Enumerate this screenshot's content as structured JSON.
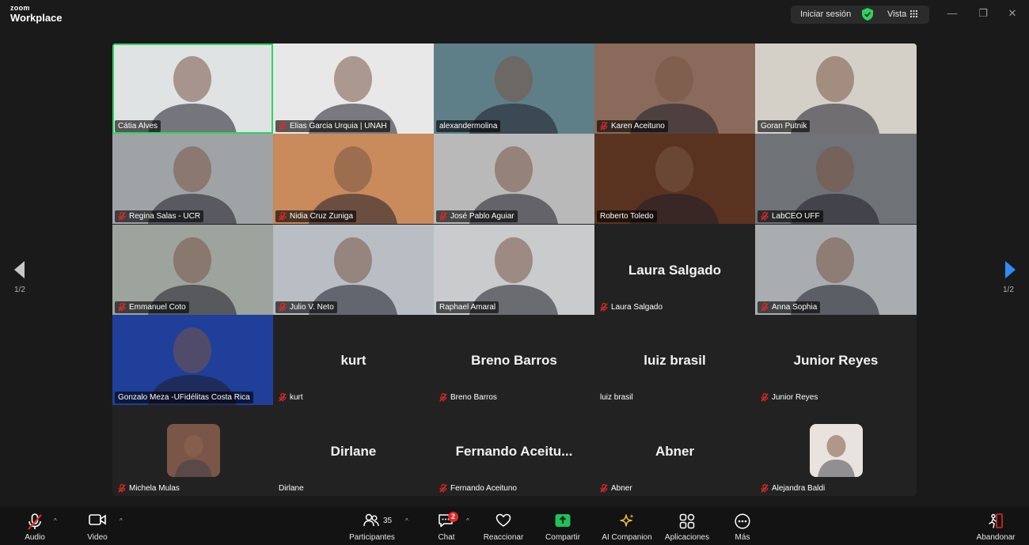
{
  "app": {
    "logo_small": "zoom",
    "logo_main": "Workplace",
    "signin_label": "Iniciar sesión",
    "view_label": "Vista"
  },
  "navigation": {
    "left_page": "1/2",
    "right_page": "1/2"
  },
  "participants": [
    {
      "name": "Cátia Alves",
      "muted": false,
      "video": true,
      "active": true,
      "color": "#dfe3e4"
    },
    {
      "name": "Elias Garcia Urquia | UNAH",
      "muted": true,
      "video": true,
      "color": "#e8e8e8"
    },
    {
      "name": "alexandermolina",
      "muted": false,
      "video": true,
      "color": "#5e7f88"
    },
    {
      "name": "Karen Aceituno",
      "muted": true,
      "video": true,
      "color": "#8a6a5a"
    },
    {
      "name": "Goran Putnik",
      "muted": false,
      "video": true,
      "color": "#d4d0c8"
    },
    {
      "name": "Regina Salas - UCR",
      "muted": true,
      "video": true,
      "color": "#9fa3a6"
    },
    {
      "name": "Nidia Cruz Zuniga",
      "muted": true,
      "video": true,
      "color": "#c98a5c"
    },
    {
      "name": "José Pablo Aguiar",
      "muted": true,
      "video": true,
      "color": "#b9b9b9"
    },
    {
      "name": "Roberto Toledo",
      "muted": false,
      "video": true,
      "color": "#5a3320"
    },
    {
      "name": "LabCEO UFF",
      "muted": true,
      "video": true,
      "color": "#6f7277"
    },
    {
      "name": "Emmanuel Coto",
      "muted": true,
      "video": true,
      "color": "#9da39d"
    },
    {
      "name": "Julio V. Neto",
      "muted": true,
      "video": true,
      "color": "#b8bec4"
    },
    {
      "name": "Raphael Amaral",
      "muted": false,
      "video": true,
      "color": "#c9cbcc"
    },
    {
      "name": "Laura Salgado",
      "muted": true,
      "video": false,
      "display": "Laura Salgado"
    },
    {
      "name": "Anna Sophia",
      "muted": true,
      "video": true,
      "color": "#a9adb0"
    },
    {
      "name": "Gonzalo Meza -UFidélitas Costa Rica",
      "muted": false,
      "video": true,
      "color": "#1f3f9a"
    },
    {
      "name": "kurt",
      "muted": true,
      "video": false,
      "display": "kurt"
    },
    {
      "name": "Breno Barros",
      "muted": true,
      "video": false,
      "display": "Breno Barros"
    },
    {
      "name": "luiz brasil",
      "muted": false,
      "video": false,
      "display": "luiz brasil"
    },
    {
      "name": "Junior Reyes",
      "muted": true,
      "video": false,
      "display": "Junior Reyes"
    },
    {
      "name": "Michela Mulas",
      "muted": true,
      "video": false,
      "avatar": true,
      "avatar_color": "#7a5648"
    },
    {
      "name": "Dirlane",
      "muted": false,
      "video": false,
      "display": "Dirlane"
    },
    {
      "name": "Fernando Aceituno",
      "muted": true,
      "video": false,
      "display": "Fernando  Aceitu..."
    },
    {
      "name": "Abner",
      "muted": true,
      "video": false,
      "display": "Abner"
    },
    {
      "name": "Alejandra Baldi",
      "muted": true,
      "video": false,
      "avatar": true,
      "avatar_color": "#e9e3df"
    }
  ],
  "toolbar": {
    "audio": "Audio",
    "video": "Video",
    "participants": "Participantes",
    "participants_count": "35",
    "chat": "Chat",
    "chat_badge": "2",
    "react": "Reaccionar",
    "share": "Compartir",
    "ai": "AI Companion",
    "apps": "Aplicaciones",
    "more": "Más",
    "leave": "Abandonar"
  },
  "colors": {
    "active_speaker": "#2fd35f",
    "share_green": "#1fc15b",
    "muted_red": "#e02828",
    "ai_yellow": "#f0c23a"
  }
}
